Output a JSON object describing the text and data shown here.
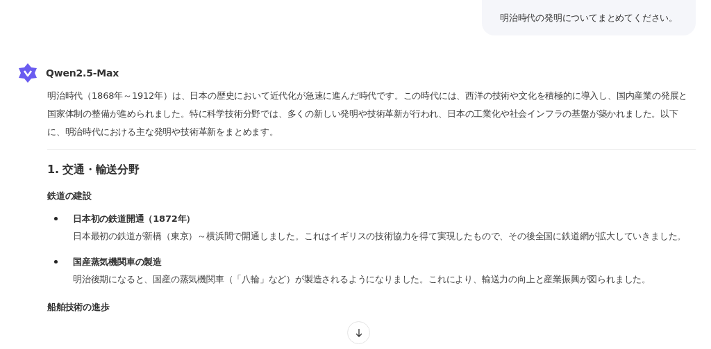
{
  "user_message": "明治時代の発明についてまとめてください。",
  "assistant": {
    "name": "Qwen2.5-Max",
    "intro": "明治時代（1868年～1912年）は、日本の歴史において近代化が急速に進んだ時代です。この時代には、西洋の技術や文化を積極的に導入し、国内産業の発展と国家体制の整備が進められました。特に科学技術分野では、多くの新しい発明や技術革新が行われ、日本の工業化や社会インフラの基盤が築かれました。以下に、明治時代における主な発明や技術革新をまとめます。",
    "sections": [
      {
        "heading": "1. 交通・輸送分野",
        "subsections": [
          {
            "title": "鉄道の建設",
            "items": [
              {
                "title": "日本初の鉄道開通（1872年）",
                "text": "日本最初の鉄道が新橋（東京）～横浜間で開通しました。これはイギリスの技術協力を得て実現したもので、その後全国に鉄道網が拡大していきました。"
              },
              {
                "title": "国産蒸気機関車の製造",
                "text": "明治後期になると、国産の蒸気機関車（「八輪」など）が製造されるようになりました。これにより、輸送力の向上と産業振興が図られました。"
              }
            ]
          },
          {
            "title": "船舶技術の進歩"
          }
        ]
      }
    ]
  }
}
